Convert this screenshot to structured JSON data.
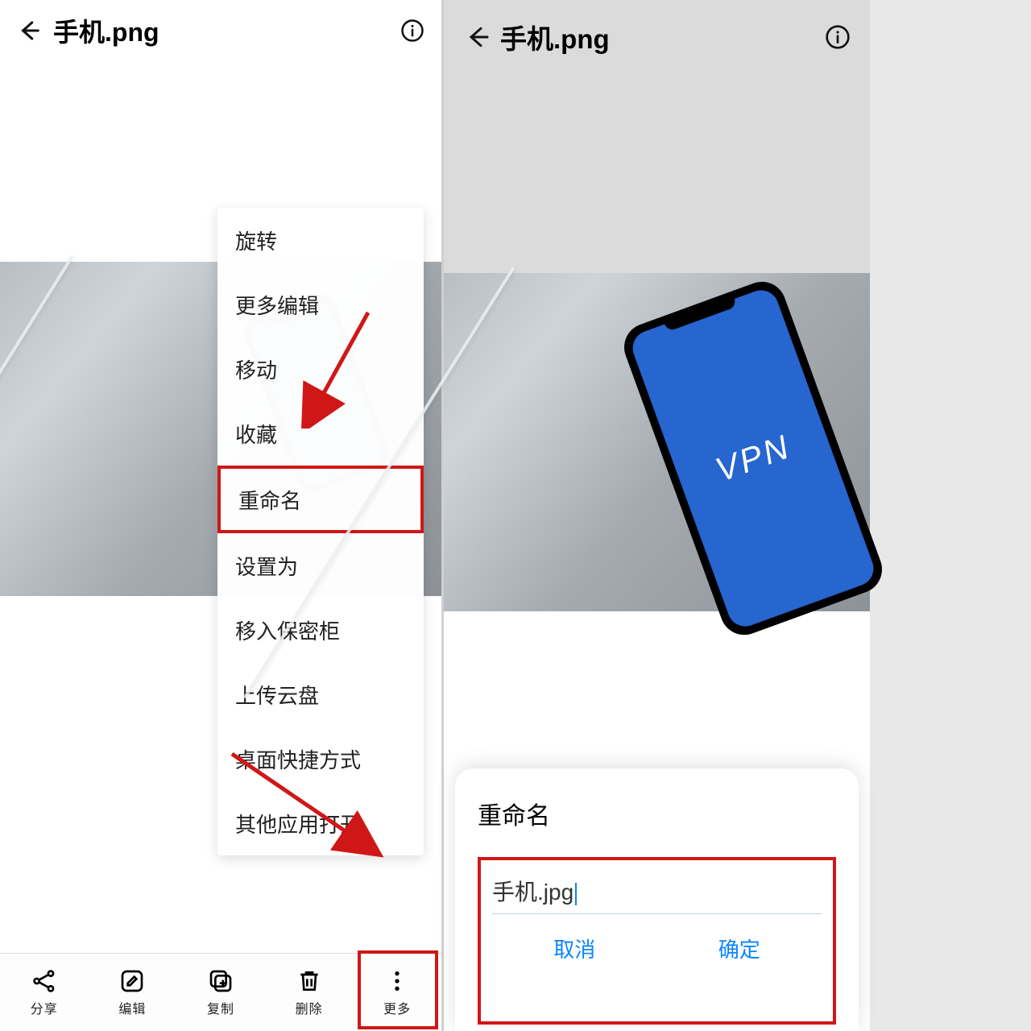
{
  "left": {
    "title": "手机.png",
    "menu": {
      "items": [
        "旋转",
        "更多编辑",
        "移动",
        "收藏",
        "重命名",
        "设置为",
        "移入保密柜",
        "上传云盘",
        "桌面快捷方式",
        "其他应用打开"
      ],
      "highlight_index": 4
    },
    "bottom": {
      "items": [
        {
          "icon": "share-icon",
          "label": "分享"
        },
        {
          "icon": "edit-icon",
          "label": "编辑"
        },
        {
          "icon": "copy-icon",
          "label": "复制"
        },
        {
          "icon": "delete-icon",
          "label": "删除"
        },
        {
          "icon": "more-icon",
          "label": "更多"
        }
      ],
      "highlight_index": 4
    }
  },
  "right": {
    "title": "手机.png",
    "vpn_label": "VPN",
    "dialog": {
      "title": "重命名",
      "value": "手机.jpg",
      "cancel": "取消",
      "confirm": "确定"
    }
  },
  "annotation_color": "#d01717"
}
